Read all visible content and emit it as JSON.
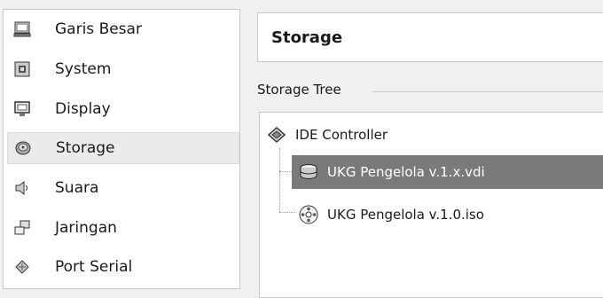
{
  "sidebar": {
    "items": [
      {
        "label": "Garis Besar",
        "icon": "monitor-general-icon"
      },
      {
        "label": "System",
        "icon": "chip-icon"
      },
      {
        "label": "Display",
        "icon": "display-icon"
      },
      {
        "label": "Storage",
        "icon": "disk-icon",
        "selected": true
      },
      {
        "label": "Suara",
        "icon": "speaker-icon"
      },
      {
        "label": "Jaringan",
        "icon": "network-icon"
      },
      {
        "label": "Port Serial",
        "icon": "serial-port-icon"
      }
    ]
  },
  "main": {
    "title": "Storage",
    "tree_label": "Storage Tree",
    "tree": {
      "controller": "IDE Controller",
      "items": [
        {
          "label": "UKG Pengelola v.1.x.vdi",
          "icon": "hard-disk-icon",
          "selected": true
        },
        {
          "label": "UKG Pengelola v.1.0.iso",
          "icon": "optical-disc-icon"
        }
      ]
    }
  },
  "colors": {
    "selected_row": "#7a7a7a",
    "sidebar_selected": "#ebebeb"
  }
}
